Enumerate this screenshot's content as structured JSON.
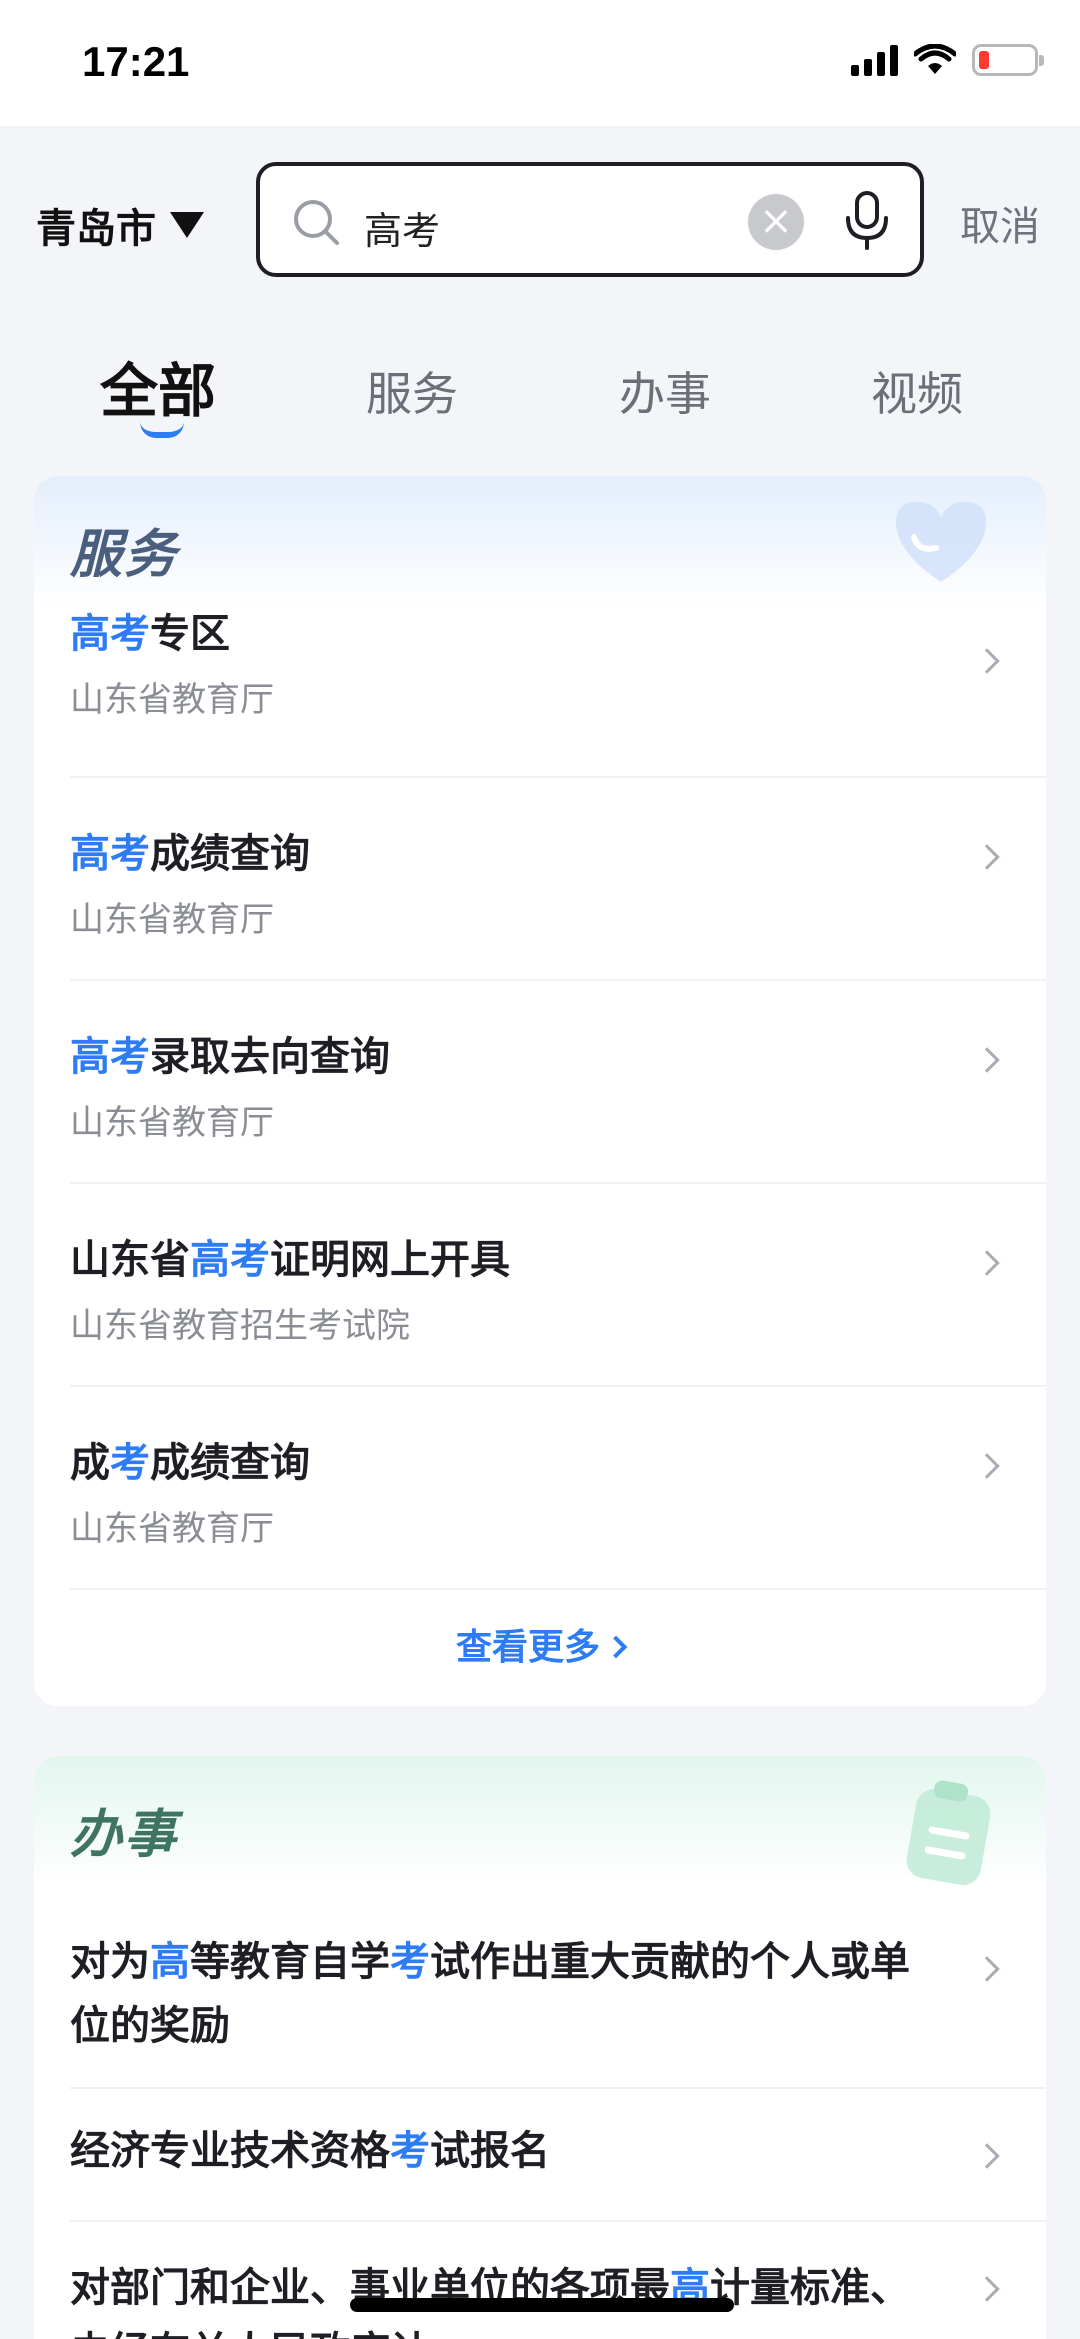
{
  "status_bar": {
    "time": "17:21"
  },
  "header": {
    "city": "青岛市",
    "search_value": "高考",
    "cancel_label": "取消"
  },
  "tabs": [
    {
      "label": "全部",
      "active": true
    },
    {
      "label": "服务",
      "active": false
    },
    {
      "label": "办事",
      "active": false
    },
    {
      "label": "视频",
      "active": false
    }
  ],
  "services": {
    "title": "服务",
    "items": [
      {
        "title_parts": [
          "高考",
          "专区"
        ],
        "subtitle": "山东省教育厅"
      },
      {
        "title_parts": [
          "高考",
          "成绩查询"
        ],
        "subtitle": "山东省教育厅"
      },
      {
        "title_parts": [
          "高考",
          "录取去向查询"
        ],
        "subtitle": "山东省教育厅"
      },
      {
        "title_parts": [
          "山东省",
          "高考",
          "证明网上开具"
        ],
        "subtitle": "山东省教育招生考试院"
      },
      {
        "title_parts": [
          "成",
          "考",
          "成绩查询"
        ],
        "subtitle": "山东省教育厅"
      }
    ],
    "more_label": "查看更多"
  },
  "affairs": {
    "title": "办事",
    "items": [
      {
        "title": "对为高等教育自学考试作出重大贡献的个人或单位的奖励"
      },
      {
        "title": "经济专业技术资格考试报名"
      },
      {
        "title": "对部门和企业、事业单位的各项最高计量标准、未经有关人民政府计"
      }
    ]
  },
  "colors": {
    "accent": "#2d7cf6",
    "service_title": "#4a5f7e",
    "affairs_title": "#3f7461"
  }
}
